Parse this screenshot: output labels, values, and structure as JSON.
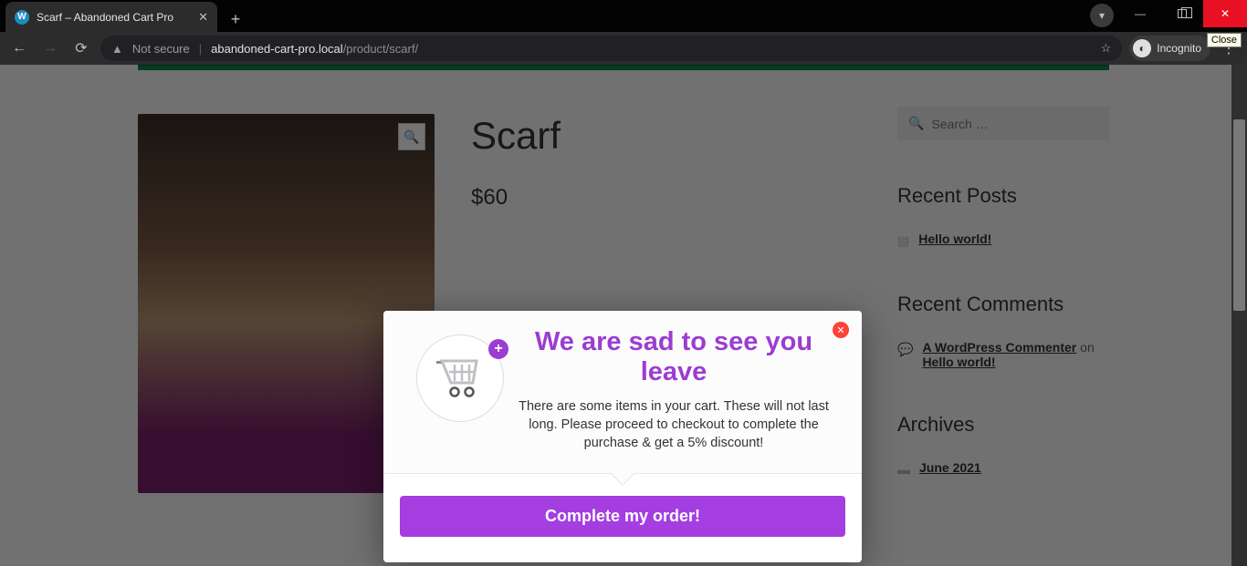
{
  "browser": {
    "tab_title": "Scarf – Abandoned Cart Pro",
    "close_tooltip": "Close",
    "not_secure": "Not secure",
    "url_host": "abandoned-cart-pro.local",
    "url_path": "/product/scarf/",
    "incognito_label": "Incognito"
  },
  "product": {
    "title": "Scarf",
    "price": "$60"
  },
  "sidebar": {
    "search_placeholder": "Search …",
    "recent_posts_heading": "Recent Posts",
    "recent_posts": [
      "Hello world!"
    ],
    "recent_comments_heading": "Recent Comments",
    "recent_comments": [
      {
        "author": "A WordPress Commenter",
        "on": " on ",
        "post": "Hello world!"
      }
    ],
    "archives_heading": "Archives",
    "archives": [
      "June 2021"
    ]
  },
  "modal": {
    "heading": "We are sad to see you leave",
    "message": "There are some items in your cart. These will not last long. Please proceed to checkout to complete the purchase & get a 5% discount!",
    "cta_label": "Complete my order!"
  }
}
